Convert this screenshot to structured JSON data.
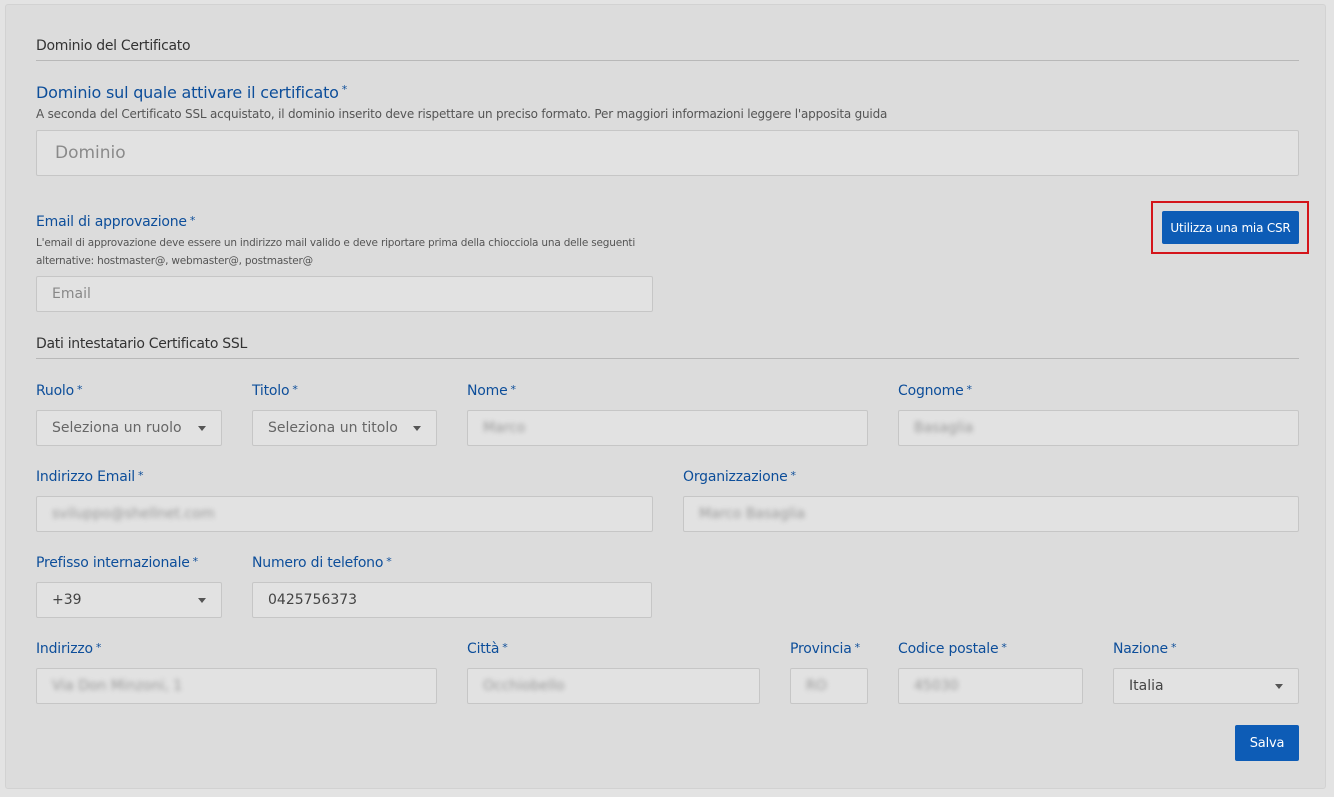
{
  "sections": {
    "domain": "Dominio del Certificato",
    "holder": "Dati intestatario Certificato SSL"
  },
  "domain": {
    "label": "Dominio sul quale attivare il certificato",
    "required": "*",
    "help": "A seconda del Certificato SSL acquistato, il dominio inserito deve rispettare un preciso formato. Per maggiori informazioni leggere l'apposita guida",
    "placeholder": "Dominio"
  },
  "approval_email": {
    "label": "Email di approvazione",
    "required": "*",
    "help_line1": "L'email di approvazione deve essere un indirizzo mail valido e deve riportare prima della chiocciola una delle seguenti",
    "help_line2": "alternative: hostmaster@, webmaster@, postmaster@",
    "placeholder": "Email"
  },
  "csr_button": {
    "label": "Utilizza una mia CSR"
  },
  "holder": {
    "role": {
      "label": "Ruolo",
      "required": "*",
      "value": "Seleziona un ruolo"
    },
    "title": {
      "label": "Titolo",
      "required": "*",
      "value": "Seleziona un titolo"
    },
    "first_name": {
      "label": "Nome",
      "required": "*",
      "value": "Marco"
    },
    "last_name": {
      "label": "Cognome",
      "required": "*",
      "value": "Basaglia"
    },
    "email": {
      "label": "Indirizzo Email",
      "required": "*",
      "value": "sviluppo@shellnet.com"
    },
    "organization": {
      "label": "Organizzazione",
      "required": "*",
      "value": "Marco Basaglia"
    },
    "prefix": {
      "label": "Prefisso internazionale",
      "required": "*",
      "value": "+39"
    },
    "phone": {
      "label": "Numero di telefono",
      "required": "*",
      "value": "0425756373"
    },
    "address": {
      "label": "Indirizzo",
      "required": "*",
      "value": "Via Don Minzoni, 1"
    },
    "city": {
      "label": "Città",
      "required": "*",
      "value": "Occhiobello"
    },
    "province": {
      "label": "Provincia",
      "required": "*",
      "value": "RO"
    },
    "postal_code": {
      "label": "Codice postale",
      "required": "*",
      "value": "45030"
    },
    "country": {
      "label": "Nazione",
      "required": "*",
      "value": "Italia"
    }
  },
  "save_button": {
    "label": "Salva"
  },
  "colors": {
    "accent": "#0d5cb6",
    "label": "#0d4e9a",
    "highlight": "#d4151b"
  }
}
